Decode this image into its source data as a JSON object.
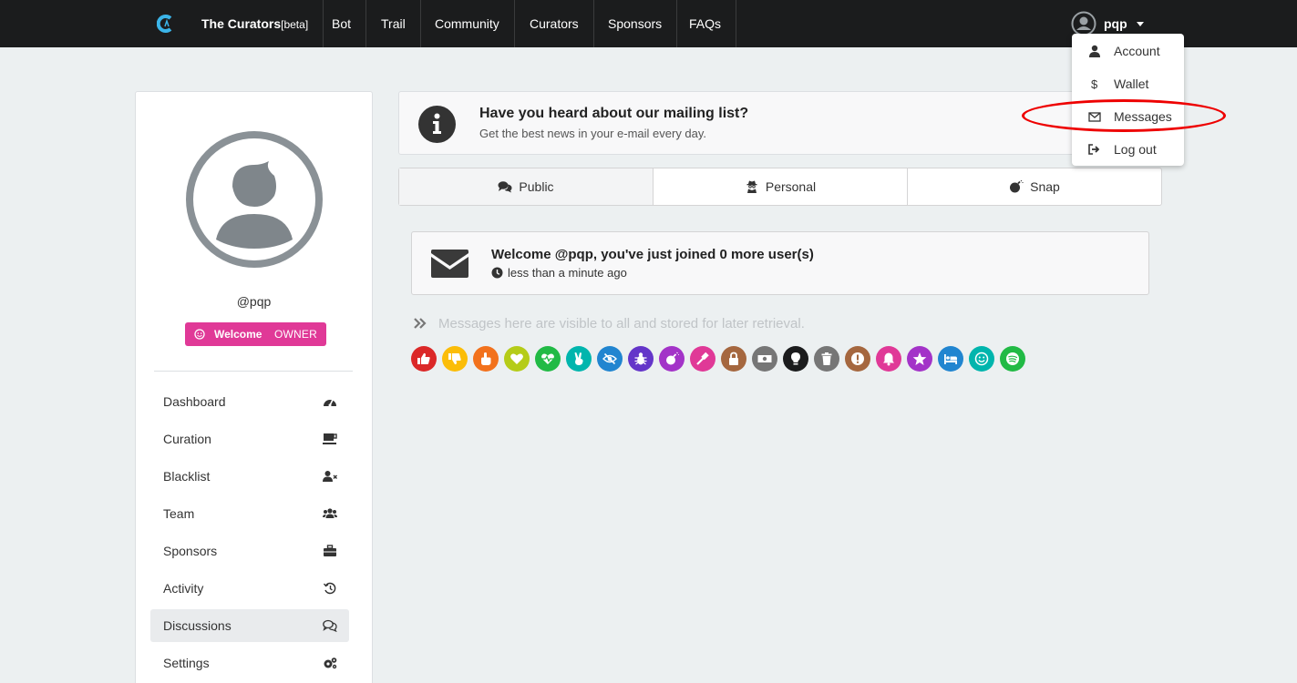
{
  "navbar": {
    "brand": "The Curators",
    "brand_tag": "[beta]",
    "items": [
      "Bot",
      "Trail",
      "Community",
      "Curators",
      "Sponsors",
      "FAQs"
    ],
    "username": "pqp"
  },
  "user_dropdown": {
    "items": [
      {
        "label": "Account",
        "icon": "user-icon"
      },
      {
        "label": "Wallet",
        "icon": "dollar-icon"
      },
      {
        "label": "Messages",
        "icon": "envelope-icon"
      },
      {
        "label": "Log out",
        "icon": "logout-icon"
      }
    ],
    "highlighted": "Messages"
  },
  "sidebar": {
    "handle": "@pqp",
    "badge_label": "Welcome",
    "badge_role": "OWNER",
    "menu": [
      {
        "label": "Dashboard",
        "icon": "tachometer-icon"
      },
      {
        "label": "Curation",
        "icon": "coffee-icon"
      },
      {
        "label": "Blacklist",
        "icon": "user-times-icon"
      },
      {
        "label": "Team",
        "icon": "users-icon"
      },
      {
        "label": "Sponsors",
        "icon": "briefcase-icon"
      },
      {
        "label": "Activity",
        "icon": "history-icon"
      },
      {
        "label": "Discussions",
        "icon": "comments-icon"
      },
      {
        "label": "Settings",
        "icon": "cogs-icon"
      }
    ],
    "active": "Discussions"
  },
  "notice": {
    "title": "Have you heard about our mailing list?",
    "subtitle": "Get the best news in your e-mail every day."
  },
  "tabs": [
    {
      "label": "Public",
      "icon": "comments-icon",
      "active": true
    },
    {
      "label": "Personal",
      "icon": "user-secret-icon",
      "active": false
    },
    {
      "label": "Snap",
      "icon": "bomb-icon",
      "active": false
    }
  ],
  "welcome_message": {
    "title": "Welcome @pqp, you've just joined 0 more user(s)",
    "time": "less than a minute ago"
  },
  "message_input": {
    "placeholder": "Messages here are visible to all and stored for later retrieval."
  },
  "reactions": [
    {
      "icon": "thumbs-up-icon",
      "color": "#db2828"
    },
    {
      "icon": "thumbs-down-icon",
      "color": "#fbbd08"
    },
    {
      "icon": "hand-point-icon",
      "color": "#f2711c"
    },
    {
      "icon": "heart-icon",
      "color": "#b5cc18"
    },
    {
      "icon": "heartbeat-icon",
      "color": "#21ba45"
    },
    {
      "icon": "peace-hand-icon",
      "color": "#00b5ad"
    },
    {
      "icon": "eye-slash-icon",
      "color": "#2185d0"
    },
    {
      "icon": "bug-icon",
      "color": "#6435c9"
    },
    {
      "icon": "bomb-icon",
      "color": "#a333c8"
    },
    {
      "icon": "gavel-icon",
      "color": "#e03997"
    },
    {
      "icon": "lock-icon",
      "color": "#a5673f"
    },
    {
      "icon": "money-icon",
      "color": "#767676"
    },
    {
      "icon": "lightbulb-icon",
      "color": "#1b1c1d"
    },
    {
      "icon": "trash-icon",
      "color": "#767676"
    },
    {
      "icon": "exclamation-icon",
      "color": "#a5673f"
    },
    {
      "icon": "bell-icon",
      "color": "#e03997"
    },
    {
      "icon": "star-icon",
      "color": "#a333c8"
    },
    {
      "icon": "bed-icon",
      "color": "#2185d0"
    },
    {
      "icon": "smile-icon",
      "color": "#00b5ad"
    },
    {
      "icon": "spotify-icon",
      "color": "#21ba45"
    }
  ]
}
